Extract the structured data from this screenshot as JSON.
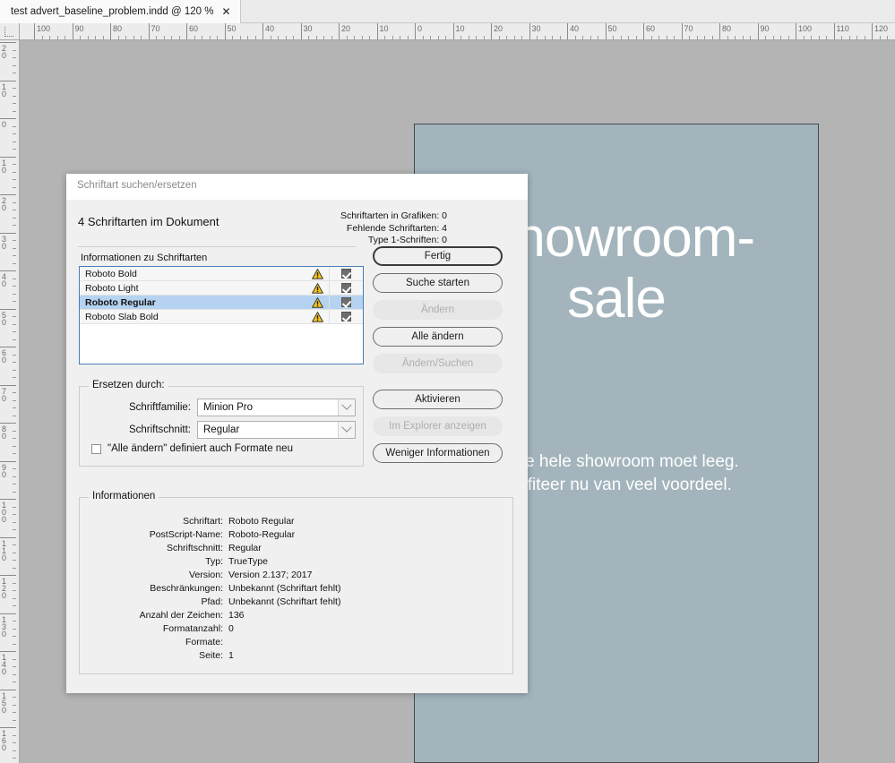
{
  "tab": {
    "title": "test advert_baseline_problem.indd @ 120 %",
    "close_icon": "close-icon"
  },
  "rulers": {
    "horizontal_labels": [
      "100",
      "90",
      "80",
      "70",
      "60",
      "50",
      "40",
      "30",
      "20",
      "10",
      "0",
      "10",
      "20",
      "30",
      "40",
      "50",
      "60",
      "70",
      "80",
      "90",
      "100",
      "110",
      "120"
    ],
    "vertical_labels": [
      "20",
      "10",
      "0",
      "10",
      "20",
      "30",
      "40",
      "50",
      "60",
      "70",
      "80",
      "90",
      "100",
      "110",
      "120",
      "130",
      "140",
      "150",
      "160"
    ],
    "unit_hint": "mm"
  },
  "document": {
    "headline": "Showroom-\nsale",
    "body": "Onze hele showroom moet leeg.\nProfiteer nu van veel voordeel.",
    "page_color": "#a3b4bc",
    "text_color": "#ffffff"
  },
  "dialog": {
    "title": "Schriftart suchen/ersetzen",
    "document_fonts_summary": "4 Schriftarten im Dokument",
    "stats": [
      "Schriftarten in Grafiken: 0",
      "Fehlende Schriftarten: 4",
      "Type 1-Schriften: 0"
    ],
    "list_label": "Informationen zu Schriftarten",
    "fonts": [
      {
        "name": "Roboto Bold",
        "warning_icon": "warning-triangle-icon",
        "checked": true,
        "selected": false
      },
      {
        "name": "Roboto Light",
        "warning_icon": "warning-triangle-icon",
        "checked": true,
        "selected": false
      },
      {
        "name": "Roboto Regular",
        "warning_icon": "warning-triangle-icon",
        "checked": true,
        "selected": true
      },
      {
        "name": "Roboto Slab Bold",
        "warning_icon": "warning-triangle-icon",
        "checked": true,
        "selected": false
      }
    ],
    "buttons": [
      {
        "label": "Fertig",
        "state": "default"
      },
      {
        "label": "Suche starten",
        "state": "enabled"
      },
      {
        "label": "Ändern",
        "state": "disabled"
      },
      {
        "label": "Alle ändern",
        "state": "enabled"
      },
      {
        "label": "Ändern/Suchen",
        "state": "disabled"
      },
      {
        "label": "Aktivieren",
        "state": "enabled"
      },
      {
        "label": "Im Explorer anzeigen",
        "state": "disabled"
      },
      {
        "label": "Weniger Informationen",
        "state": "enabled"
      }
    ],
    "replace_group": {
      "legend": "Ersetzen durch:",
      "family_label": "Schriftfamilie:",
      "family_value": "Minion Pro",
      "style_label": "Schriftschnitt:",
      "style_value": "Regular",
      "redefine_checkbox_label": "\"Alle ändern\" definiert auch Formate neu",
      "redefine_checked": false
    },
    "info_group": {
      "legend": "Informationen",
      "rows": [
        {
          "key": "Schriftart:",
          "value": "Roboto Regular"
        },
        {
          "key": "PostScript-Name:",
          "value": "Roboto-Regular"
        },
        {
          "key": "Schriftschnitt:",
          "value": "Regular"
        },
        {
          "key": "Typ:",
          "value": "TrueType"
        },
        {
          "key": "Version:",
          "value": "Version 2.137; 2017"
        },
        {
          "key": "Beschränkungen:",
          "value": "Unbekannt (Schriftart fehlt)"
        },
        {
          "key": "Pfad:",
          "value": "Unbekannt (Schriftart fehlt)"
        },
        {
          "key": "Anzahl der Zeichen:",
          "value": "136"
        },
        {
          "key": "Formatanzahl:",
          "value": "0"
        },
        {
          "key": "Formate:",
          "value": ""
        },
        {
          "key": "Seite:",
          "value": "1"
        }
      ]
    }
  },
  "colors": {
    "selection_blue": "#b5d3f0",
    "list_border_blue": "#4a7db5",
    "warning_yellow": "#f5c518",
    "canvas_gray": "#b4b4b4"
  }
}
